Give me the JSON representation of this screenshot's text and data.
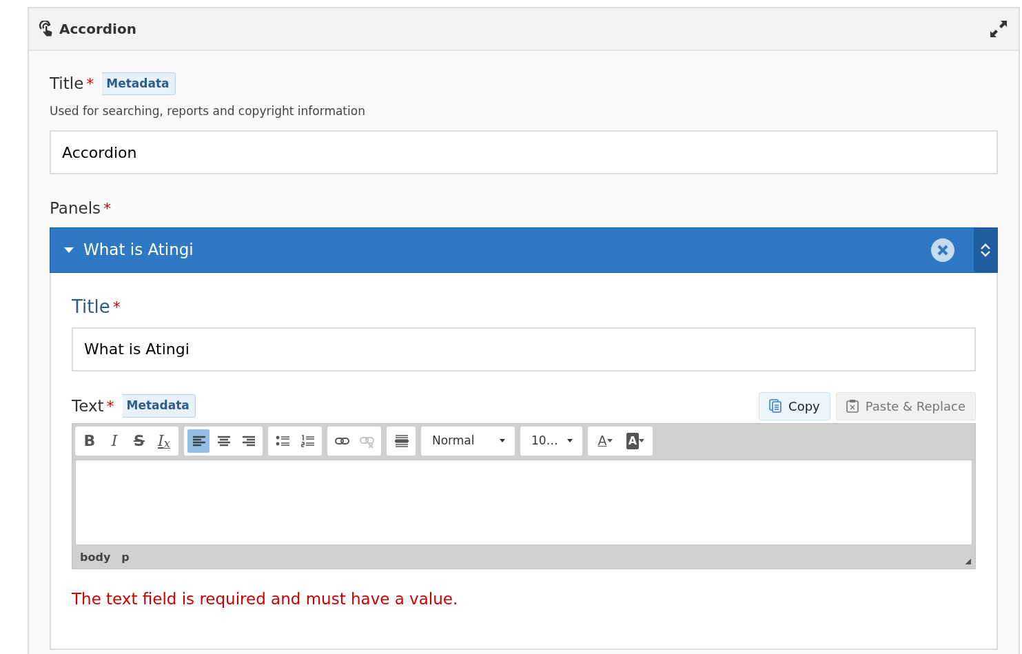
{
  "header": {
    "title": "Accordion"
  },
  "title_field": {
    "label": "Title",
    "required_mark": "*",
    "tag": "Metadata",
    "description": "Used for searching, reports and copyright information",
    "value": "Accordion"
  },
  "panels": {
    "label": "Panels",
    "required_mark": "*",
    "items": [
      {
        "title": "What is Atingi",
        "expanded": true,
        "title_field": {
          "label": "Title",
          "required_mark": "*",
          "value": "What is Atingi"
        },
        "text_field": {
          "label": "Text",
          "required_mark": "*",
          "tag": "Metadata",
          "copy_button": {
            "label": "Copy",
            "disabled": false
          },
          "paste_button": {
            "label": "Paste & Replace",
            "disabled": true
          },
          "toolbar": [
            {
              "kind": "group",
              "buttons": [
                {
                  "kind": "bold",
                  "label": "B",
                  "selected": false,
                  "disabled": false
                },
                {
                  "kind": "italic",
                  "label": "I",
                  "selected": false,
                  "disabled": false
                },
                {
                  "kind": "strike",
                  "label": "S",
                  "selected": false,
                  "disabled": false
                },
                {
                  "kind": "clear",
                  "label": "I$_{x}$",
                  "selected": false,
                  "disabled": false
                }
              ]
            },
            {
              "kind": "group",
              "buttons": [
                {
                  "kind": "align-left",
                  "selected": true,
                  "disabled": false
                },
                {
                  "kind": "align-center",
                  "selected": false,
                  "disabled": false
                },
                {
                  "kind": "align-right",
                  "selected": false,
                  "disabled": false
                }
              ]
            },
            {
              "kind": "group",
              "buttons": [
                {
                  "kind": "bullets",
                  "selected": false,
                  "disabled": false
                },
                {
                  "kind": "numbers",
                  "selected": false,
                  "disabled": false
                }
              ]
            },
            {
              "kind": "group",
              "buttons": [
                {
                  "kind": "link",
                  "selected": false,
                  "disabled": false
                },
                {
                  "kind": "unlink",
                  "selected": false,
                  "disabled": true
                }
              ]
            },
            {
              "kind": "group",
              "buttons": [
                {
                  "kind": "rule",
                  "selected": false,
                  "disabled": false
                }
              ]
            },
            {
              "kind": "format-dropdown",
              "value": "Normal"
            },
            {
              "kind": "size-dropdown",
              "value": "10…"
            },
            {
              "kind": "group",
              "buttons": [
                {
                  "kind": "text-color",
                  "label": "A",
                  "selected": false,
                  "disabled": false
                },
                {
                  "kind": "bg-color",
                  "label": "A",
                  "selected": false,
                  "disabled": false
                }
              ]
            }
          ],
          "path": [
            "body",
            "p"
          ],
          "error": "The text field is required and must have a value."
        }
      }
    ]
  }
}
